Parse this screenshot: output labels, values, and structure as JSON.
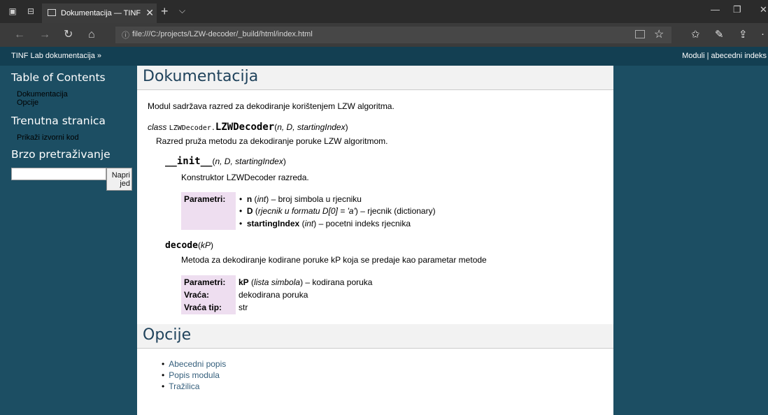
{
  "browser": {
    "tab_title": "Dokumentacija — TINF",
    "tab_close": "✕",
    "new_tab": "+",
    "tab_menu": "⌵",
    "url": "file:///C:/projects/LZW-decoder/_build/html/index.html"
  },
  "relbar": {
    "home": "TINF Lab dokumentacija »",
    "right": "Moduli | abecedni indeks"
  },
  "sidebar": {
    "toc_title": "Table of Contents",
    "toc_items": [
      "Dokumentacija",
      "Opcije"
    ],
    "this_page_title": "Trenutna stranica",
    "show_source": "Prikaži izvorni kod",
    "search_title": "Brzo pretraživanje",
    "search_value": "",
    "search_button": "Napri jed"
  },
  "main": {
    "title": "Dokumentacija",
    "intro": "Modul sadržava razred za dekodiranje korištenjem LZW algoritma.",
    "class_sig": {
      "keyword": "class",
      "module": "LZWDecoder.",
      "name": "LZWDecoder",
      "open": "(",
      "params": "n, D, startingIndex",
      "close": ")"
    },
    "class_desc": "Razred pruža metodu za dekodiranje poruke LZW algoritmom.",
    "init_sig": {
      "name": "__init__",
      "open": "(",
      "params": "n, D, startingIndex",
      "close": ")"
    },
    "init_desc": "Konstruktor LZWDecoder razreda.",
    "init_fields": {
      "label": "Parametri:",
      "params": [
        {
          "bullet": "•",
          "name": "n",
          "open": " (",
          "type": "int",
          "close": ")",
          "desc": " – broj simbola u rjecniku"
        },
        {
          "bullet": "•",
          "name": "D",
          "open": " (",
          "type": "rjecnik u formatu D[0] = 'a'",
          "close": ")",
          "desc": " – rjecnik (dictionary)"
        },
        {
          "bullet": "•",
          "name": "startingIndex",
          "open": " (",
          "type": "int",
          "close": ")",
          "desc": " – pocetni indeks rjecnika"
        }
      ]
    },
    "decode_sig": {
      "name": "decode",
      "open": "(",
      "params": "kP",
      "close": ")"
    },
    "decode_desc": "Metoda za dekodiranje kodirane poruke kP koja se predaje kao parametar metode",
    "decode_fields": {
      "param_label": "Parametri:",
      "param_name": "kP",
      "param_open": " (",
      "param_type": "lista simbola",
      "param_close": ")",
      "param_desc": " – kodirana poruka",
      "returns_label": "Vraća:",
      "returns": "dekodirana poruka",
      "rtype_label": "Vraća tip:",
      "rtype": "str"
    },
    "options_title": "Opcije",
    "options_bullet": "•",
    "options": [
      "Abecedni popis",
      "Popis modula",
      "Tražilica"
    ]
  }
}
